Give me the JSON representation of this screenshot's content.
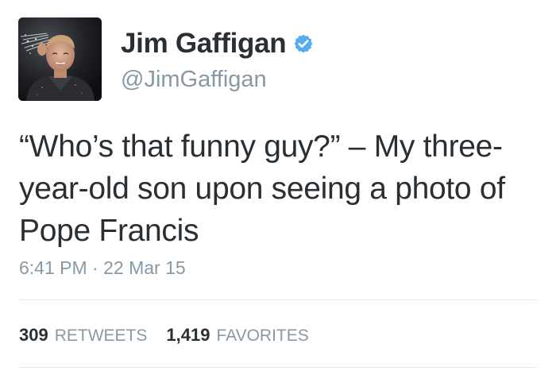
{
  "user": {
    "display_name": "Jim Gaffigan",
    "handle": "@JimGaffigan",
    "verified_icon": "verified-badge-icon",
    "verified_color": "#55acee"
  },
  "tweet": {
    "text": "“Who’s that funny guy?” – My three-\nyear-old son upon seeing a photo of\nPope Francis",
    "timestamp": "6:41 PM · 22 Mar 15"
  },
  "stats": [
    {
      "count": "309",
      "label": "RETWEETS"
    },
    {
      "count": "1,419",
      "label": "FAVORITES"
    }
  ],
  "colors": {
    "text_primary": "#292f33",
    "text_secondary": "#8899a6",
    "divider": "#e1e8ed"
  }
}
